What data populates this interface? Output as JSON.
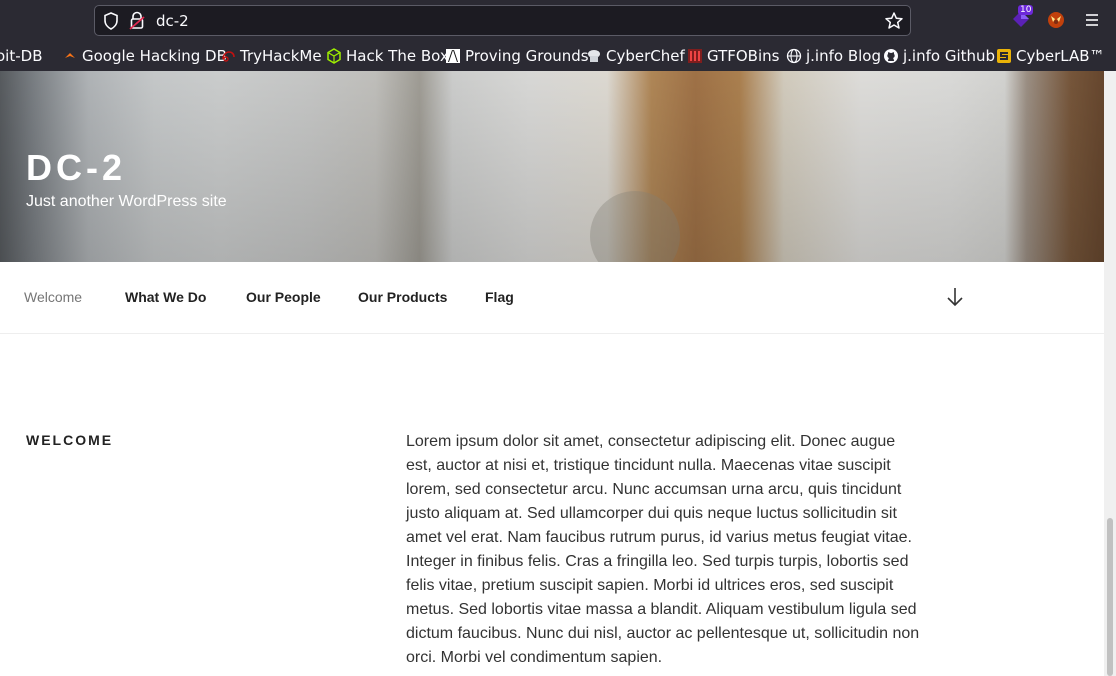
{
  "browser": {
    "url": "dc-2",
    "extension_badge": "10",
    "bookmarks": [
      {
        "label": "oit-DB",
        "icon": "exploit-db-icon"
      },
      {
        "label": "Google Hacking DB",
        "icon": "ghdb-icon"
      },
      {
        "label": "TryHackMe",
        "icon": "tryhackme-icon"
      },
      {
        "label": "Hack The Box",
        "icon": "hackthebox-icon"
      },
      {
        "label": "Proving Grounds",
        "icon": "proving-grounds-icon"
      },
      {
        "label": "CyberChef",
        "icon": "cyberchef-icon"
      },
      {
        "label": "GTFOBins",
        "icon": "gtfobins-icon"
      },
      {
        "label": "j.info Blog",
        "icon": "globe-icon"
      },
      {
        "label": "j.info Github",
        "icon": "github-icon"
      },
      {
        "label": "CyberLAB™",
        "icon": "cyberlab-icon"
      }
    ]
  },
  "site": {
    "title": "DC-2",
    "description": "Just another WordPress site"
  },
  "nav": {
    "items": [
      {
        "label": "Welcome"
      },
      {
        "label": "What We Do"
      },
      {
        "label": "Our People"
      },
      {
        "label": "Our Products"
      },
      {
        "label": "Flag"
      }
    ]
  },
  "content": {
    "section_title": "Welcome",
    "body": "Lorem ipsum dolor sit amet, consectetur adipiscing elit. Donec augue est, auctor at nisi et, tristique tincidunt nulla. Maecenas vitae suscipit lorem, sed consectetur arcu. Nunc accumsan urna arcu, quis tincidunt justo aliquam at. Sed ullamcorper dui quis neque luctus sollicitudin sit amet vel erat. Nam faucibus rutrum purus, id varius metus feugiat vitae. Integer in finibus felis. Cras a fringilla leo. Sed turpis turpis, lobortis sed felis vitae, pretium suscipit sapien. Morbi id ultrices eros, sed suscipit metus. Sed lobortis vitae massa a blandit. Aliquam vestibulum ligula sed dictum faucibus. Nunc dui nisl, auctor ac pellentesque ut, sollicitudin non orci. Morbi vel condimentum sapien."
  }
}
